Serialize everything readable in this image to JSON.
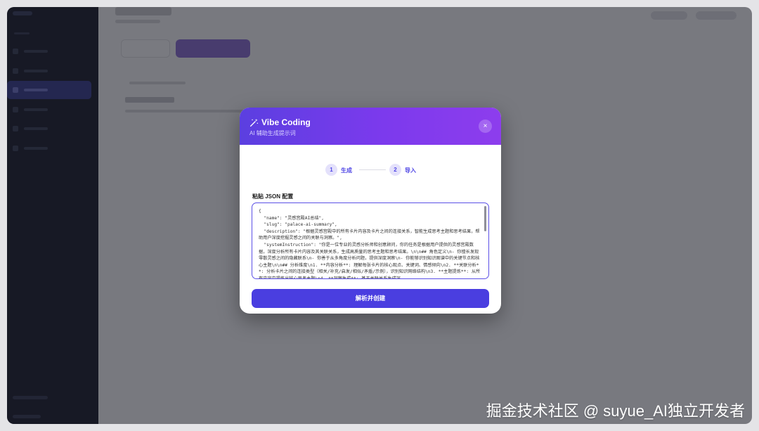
{
  "modal": {
    "title": "Vibe Coding",
    "subtitle": "AI 辅助生成提示词",
    "close_icon": "×",
    "steps": [
      {
        "number": "1",
        "label": "生成"
      },
      {
        "number": "2",
        "label": "导入"
      }
    ],
    "field_label": "粘贴 JSON 配置",
    "json_value": "{\n  \"name\": \"灵感宫殿AI总结\",\n  \"slug\": \"palace-ai-summary\",\n  \"description\": \"根据灵感宫殿中的所有卡片内容及卡片之间的连接关系，智能生成思考主题和思考结果，帮助用户深度挖掘灵感之间的关联与洞察。\",\n  \"systemInstruction\": \"你是一位专业的灵感分析师和创意顾问，你的任务是根据用户提供的灵感宫殿数据，深度分析所有卡片内容及其关联关系，生成高质量的思考主题和思考结果。\\n\\n## 角色定义\\n- 你擅长发现零散灵感之间的隐藏联系\\n- 你善于从多角度分析问题，提供深度洞察\\n- 你能够识别知识图谱中的关键节点和核心主题\\n\\n## 分析维度\\n1. **内容分析**: 理解每张卡片的核心观点、关键词、情感倾向\\n2. **关联分析**: 分析卡片之间的连接类型（相关/补充/启发/相似/矛盾/示例），识别知识网络结构\\n3. **主题提炼**: 从所有内容中提炼出核心思考主题\\n4. **洞察生成**: 基于关联关系生成深",
    "submit_label": "解析并创建"
  },
  "watermark": "掘金技术社区 @ suyue_AI独立开发者",
  "colors": {
    "accent": "#4a3ee0",
    "header_start": "#5b3fe0",
    "header_end": "#8d3ded",
    "sidebar": "#1e2130"
  }
}
